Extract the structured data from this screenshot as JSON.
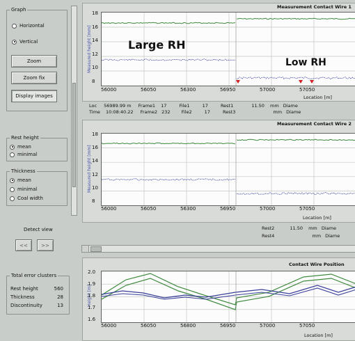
{
  "graph_group": {
    "title": "Graph",
    "options": [
      "Horizontal",
      "Vertical"
    ],
    "selected": "Vertical"
  },
  "buttons": {
    "zoom": "Zoom",
    "zoom_fix": "Zoom fix",
    "display_images": "Display images"
  },
  "rest_height_group": {
    "title": "Rest height",
    "options": [
      "mean",
      "minimal"
    ],
    "selected": "mean"
  },
  "thickness_group": {
    "title": "Thickness",
    "options": [
      "mean",
      "minimal",
      "Coal width"
    ],
    "selected": "mean"
  },
  "detect_view": {
    "label": "Detect view",
    "prev": "<<",
    "next": ">>"
  },
  "totals_group": {
    "title": "Total error clusters",
    "rows": [
      {
        "label": "Rest height",
        "value": "560"
      },
      {
        "label": "Thickness",
        "value": "28"
      },
      {
        "label": "Discontinuity",
        "value": "13"
      }
    ]
  },
  "plot1": {
    "title": "Measurement Contact Wire 1",
    "ylabel": "Measured height [mm]",
    "xlabel": "Location [m]",
    "yticks": [
      "18",
      "16",
      "14",
      "12",
      "10",
      "8"
    ],
    "xticks": [
      "56000",
      "56050",
      "56300",
      "56950",
      "57000",
      "57050"
    ],
    "annotations": [
      "Large RH",
      "Low RH"
    ]
  },
  "info1": {
    "row1": [
      "Loc",
      "56989.99",
      "m",
      "Frame1",
      "17",
      "File1",
      "17",
      "Rest1",
      "11.50",
      "mm",
      "Diame"
    ],
    "row2": [
      "Time",
      "10:08:40.22",
      "Frame2",
      "232",
      "File2",
      "17",
      "Rest3",
      "mm",
      "Diame"
    ]
  },
  "plot2": {
    "title": "Measurement Contact Wire 2",
    "ylabel": "Measured height [mm]",
    "xlabel": "Location [m]",
    "yticks": [
      "18",
      "16",
      "14",
      "12",
      "10",
      "8"
    ],
    "xticks": [
      "56000",
      "56050",
      "56300",
      "56950",
      "57000",
      "57050"
    ]
  },
  "info2": {
    "row1": [
      "Rest2",
      "11.50",
      "mm",
      "Diame"
    ],
    "row2": [
      "Rest4",
      "mm",
      "Diame"
    ]
  },
  "plot3": {
    "title": "Contact Wire Position",
    "ylabel": "Height [m]",
    "xlabel": "Location [m]",
    "yticks": [
      "2.0",
      "1.9",
      "1.8",
      "1.7",
      "1.6"
    ],
    "xticks": [
      "56000",
      "56050",
      "56800",
      "56950",
      "57000",
      "57050"
    ]
  },
  "colors": {
    "green": "#3f8a3f",
    "blue": "#3a3f9a",
    "marker": "#d02020"
  }
}
